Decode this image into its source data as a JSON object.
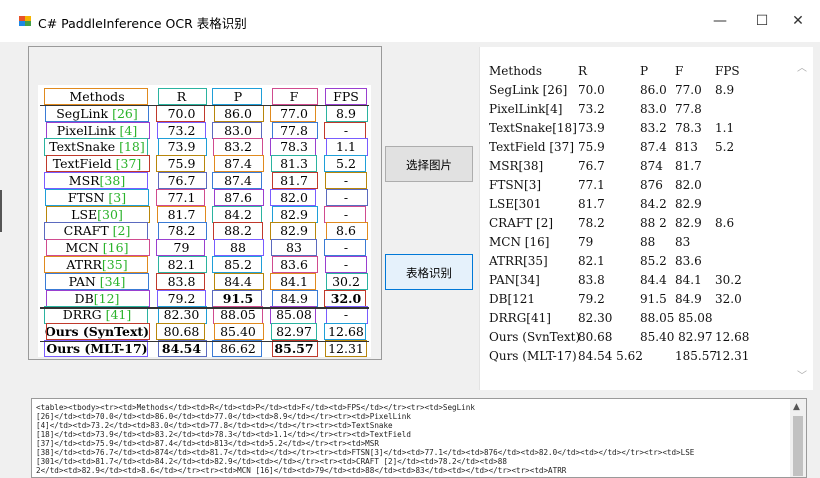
{
  "window": {
    "title": "C# PaddleInference OCR 表格识别",
    "minimize": "—",
    "maximize": "☐",
    "close": "✕"
  },
  "buttons": {
    "select_image": "选择图片",
    "table_recognize": "表格识别"
  },
  "source_table": {
    "header": [
      "Methods",
      "R",
      "P",
      "F",
      "FPS"
    ],
    "rows": [
      {
        "m": "SegLink ",
        "ref": "[26]",
        "r": "70.0",
        "p": "86.0",
        "f": "77.0",
        "fps": "8.9"
      },
      {
        "m": "PixelLink ",
        "ref": "[4]",
        "r": "73.2",
        "p": "83.0",
        "f": "77.8",
        "fps": "-"
      },
      {
        "m": "TextSnake ",
        "ref": "[18]",
        "r": "73.9",
        "p": "83.2",
        "f": "78.3",
        "fps": "1.1"
      },
      {
        "m": "TextField ",
        "ref": "[37]",
        "r": "75.9",
        "p": "87.4",
        "f": "81.3",
        "fps": "5.2"
      },
      {
        "m": "MSR",
        "ref": "[38]",
        "r": "76.7",
        "p": "87.4",
        "f": "81.7",
        "fps": "-"
      },
      {
        "m": "FTSN ",
        "ref": "[3]",
        "r": "77.1",
        "p": "87.6",
        "f": "82.0",
        "fps": "-"
      },
      {
        "m": "LSE",
        "ref": "[30]",
        "r": "81.7",
        "p": "84.2",
        "f": "82.9",
        "fps": "-"
      },
      {
        "m": "CRAFT ",
        "ref": "[2]",
        "r": "78.2",
        "p": "88.2",
        "f": "82.9",
        "fps": "8.6"
      },
      {
        "m": "MCN ",
        "ref": "[16]",
        "r": "79",
        "p": "88",
        "f": "83",
        "fps": "-"
      },
      {
        "m": "ATRR",
        "ref": "[35]",
        "r": "82.1",
        "p": "85.2",
        "f": "83.6",
        "fps": "-"
      },
      {
        "m": "PAN ",
        "ref": "[34]",
        "r": "83.8",
        "p": "84.4",
        "f": "84.1",
        "fps": "30.2"
      },
      {
        "m": "DB",
        "ref": "[12]",
        "r": "79.2",
        "p": "91.5",
        "f": "84.9",
        "fps": "32.0"
      },
      {
        "m": "DRRG ",
        "ref": "[41]",
        "r": "82.30",
        "p": "88.05",
        "f": "85.08",
        "fps": "-"
      },
      {
        "m": "Ours (SynText)",
        "ref": "",
        "r": "80.68",
        "p": "85.40",
        "f": "82.97",
        "fps": "12.68"
      },
      {
        "m": "Ours (MLT-17)",
        "ref": "",
        "r": "84.54",
        "p": "86.62",
        "f": "85.57",
        "fps": "12.31"
      }
    ]
  },
  "result_table": {
    "header": [
      "Methods",
      "R",
      "P",
      "F",
      "FPS"
    ],
    "rows": [
      [
        "SegLink [26]",
        "70.0",
        "86.0",
        "77.0",
        "8.9"
      ],
      [
        "PixelLink[4]",
        "73.2",
        "83.0",
        "77.8",
        ""
      ],
      [
        "TextSnake[18]",
        "73.9",
        "83.2",
        "78.3",
        "1.1"
      ],
      [
        "TextField [37]",
        "75.9",
        "87.4",
        "813",
        "5.2"
      ],
      [
        "MSR[38]",
        "76.7",
        "874",
        "81.7",
        ""
      ],
      [
        "FTSN[3]",
        "77.1",
        "876",
        "82.0",
        ""
      ],
      [
        "LSE[301",
        "81.7",
        "84.2",
        "82.9",
        ""
      ],
      [
        "CRAFT [2]",
        "78.2",
        "88 2",
        "82.9",
        "8.6"
      ],
      [
        "MCN [16]",
        "79",
        "88",
        "83",
        ""
      ],
      [
        "ATRR[35]",
        "82.1",
        "85.2",
        "83.6",
        ""
      ],
      [
        "PAN[34]",
        "83.8",
        "84.4",
        "84.1",
        "30.2"
      ],
      [
        "DB[121",
        "79.2",
        "91.5",
        "84.9",
        "32.0"
      ],
      [
        "DRRG[41]",
        "82.30",
        "88.05 85.08",
        "",
        ""
      ],
      [
        "Ours (SvnText)",
        "80.68",
        "85.40 82.97",
        "",
        "12.68"
      ],
      [
        "Qurs (MLT-17)",
        "84.54 5.62",
        "",
        "185.57",
        "12.31"
      ]
    ]
  },
  "html_output": [
    "<table><tbody><tr><td>Methods</td><td>R</td><td>P</td><td>F</td><td>FPS</td></tr><tr><td>SegLink",
    "[26]</td><td>70.0</td><td>86.0</td><td>77.0</td><td>8.9</td></tr><tr><td>PixelLink",
    "[4]</td><td>73.2</td><td>83.0</td><td>77.8</td><td></td></tr><tr><td>TextSnake",
    "[18]</td><td>73.9</td><td>83.2</td><td>78.3</td><td>1.1</td></tr><tr><td>TextField",
    "[37]</td><td>75.9</td><td>87.4</td><td>813</td><td>5.2</td></tr><tr><td>MSR",
    "[38]</td><td>76.7</td><td>874</td><td>81.7</td><td></td></tr><tr><td>FTSN[3]</td><td>77.1</td><td>876</td><td>82.0</td><td></td></tr><tr><td>LSE",
    "[301</td><td>81.7</td><td>84.2</td><td>82.9</td><td></td></tr><tr><td>CRAFT [2]</td><td>78.2</td><td>88",
    "2</td><td>82.9</td><td>8.6</td></tr><tr><td>MCN [16]</td><td>79</td><td>88</td><td>83</td><td></td></tr><tr><td>ATRR"
  ]
}
